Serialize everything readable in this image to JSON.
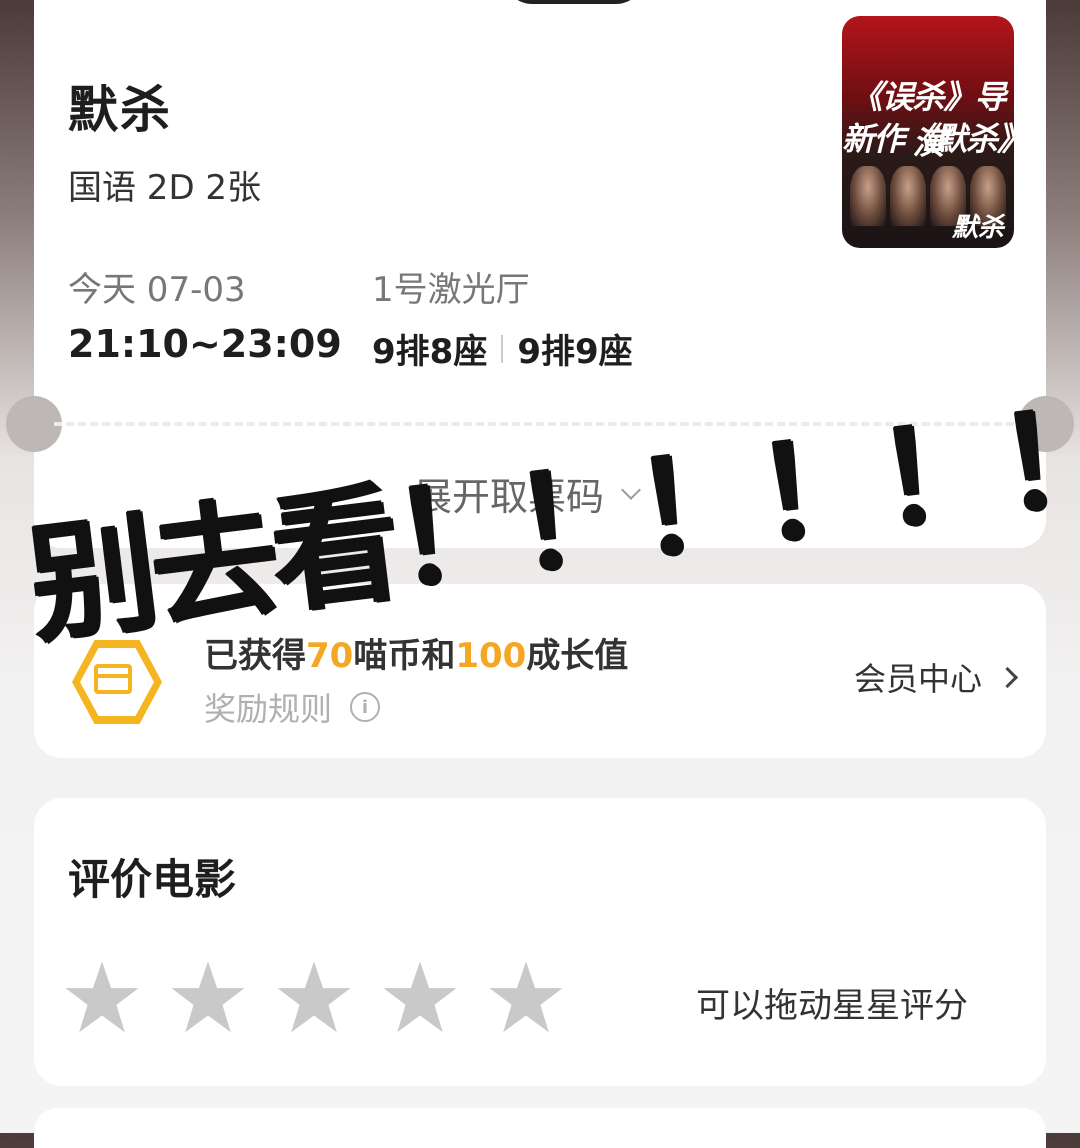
{
  "ticket": {
    "movie_title": "默杀",
    "subtitle": "国语 2D 2张",
    "day_date": "今天 07-03",
    "showtime": "21:10~23:09",
    "hall": "1号激光厅",
    "seats": [
      "9排8座",
      "9排9座"
    ],
    "expand_label": "展开取票码",
    "poster": {
      "line1": "《误杀》导演",
      "line2": "新作《默杀》",
      "logo": "默杀"
    }
  },
  "reward": {
    "prefix": "已获得",
    "coins": "70",
    "middle": "喵币和",
    "growth": "100",
    "suffix": "成长值",
    "rules_label": "奖励规则",
    "info_glyph": "i",
    "member_center": "会员中心"
  },
  "rating": {
    "title": "评价电影",
    "star_count": 5,
    "rating_value": 0,
    "hint": "可以拖动星星评分"
  },
  "overlay_text": "别去看！！！！！！",
  "colors": {
    "accent": "#f5a623",
    "star_empty": "#c9c9c9",
    "card_bg": "#ffffff"
  }
}
